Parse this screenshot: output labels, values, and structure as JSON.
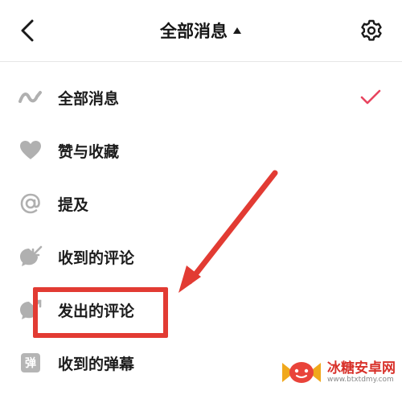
{
  "header": {
    "title": "全部消息"
  },
  "menu": {
    "items": [
      {
        "label": "全部消息",
        "icon": "wave-icon",
        "selected": true
      },
      {
        "label": "赞与收藏",
        "icon": "heart-icon",
        "selected": false
      },
      {
        "label": "提及",
        "icon": "at-sign-icon",
        "selected": false
      },
      {
        "label": "收到的评论",
        "icon": "comment-received-icon",
        "selected": false
      },
      {
        "label": "发出的评论",
        "icon": "comment-sent-icon",
        "selected": false
      },
      {
        "label": "收到的弹幕",
        "icon": "danmaku-icon",
        "selected": false
      }
    ],
    "danmaku_glyph": "弹"
  },
  "colors": {
    "accent_check": "#e8455f",
    "annotation_red": "#e23b33",
    "icon_gray": "#b0b0b0"
  },
  "watermark": {
    "name": "冰糖安卓网",
    "url": "www.btxtdmy.com"
  }
}
